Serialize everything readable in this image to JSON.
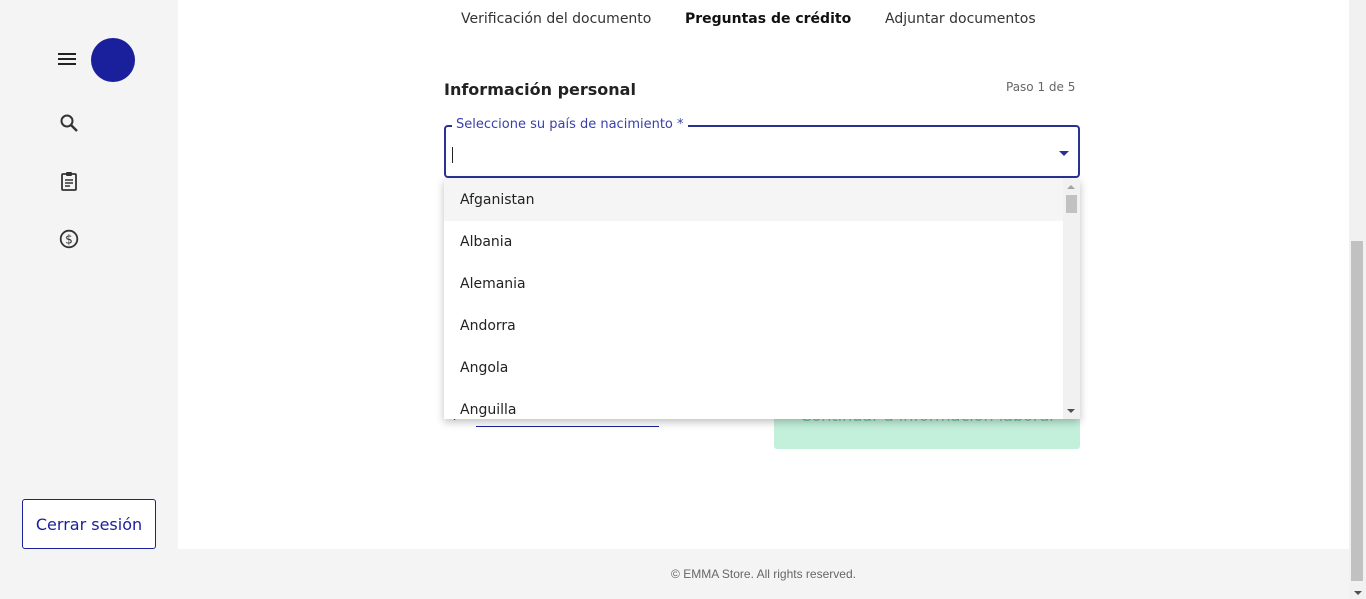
{
  "sidebar": {
    "icons": [
      "menu-icon",
      "avatar",
      "search-icon",
      "clipboard-icon",
      "dollar-icon"
    ],
    "logout_label": "Cerrar sesión",
    "accent_color": "#1a1f9c"
  },
  "tabs": [
    {
      "label": "Verificación del documento",
      "active": false
    },
    {
      "label": "Preguntas de crédito",
      "active": true
    },
    {
      "label": "Adjuntar documentos",
      "active": false
    }
  ],
  "form": {
    "section_title": "Información personal",
    "step": "Paso 1 de 5",
    "country_field": {
      "label": "Seleccione su país de nacimiento *",
      "value": ""
    },
    "continue_label": "Continuar a información laboral"
  },
  "dropdown": {
    "highlighted": "Afganistan",
    "options": [
      "Afganistan",
      "Albania",
      "Alemania",
      "Andorra",
      "Angola",
      "Anguilla"
    ]
  },
  "footer": {
    "text": "© EMMA Store. All rights reserved."
  }
}
